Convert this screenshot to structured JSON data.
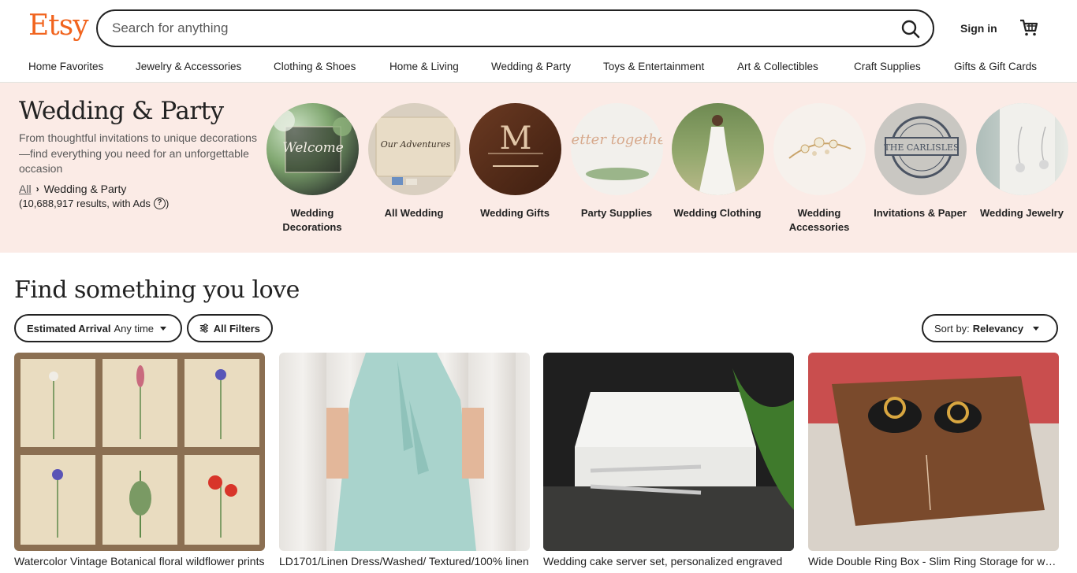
{
  "header": {
    "logo": "Etsy",
    "search_placeholder": "Search for anything",
    "sign_in": "Sign in"
  },
  "nav": [
    "Home Favorites",
    "Jewelry & Accessories",
    "Clothing & Shoes",
    "Home & Living",
    "Wedding & Party",
    "Toys & Entertainment",
    "Art & Collectibles",
    "Craft Supplies",
    "Gifts & Gift Cards"
  ],
  "hero": {
    "title": "Wedding & Party",
    "description": "From thoughtful invitations to unique decorations—find everything you need for an unforgettable occasion",
    "breadcrumb_all": "All",
    "breadcrumb_current": "Wedding & Party",
    "results_text": "(10,688,917 results, with Ads",
    "results_close": ")"
  },
  "categories": [
    {
      "label": "Wedding Decorations",
      "image_text": "Welcome"
    },
    {
      "label": "All Wedding",
      "image_text": "Our Adventures"
    },
    {
      "label": "Wedding Gifts",
      "image_text": "M"
    },
    {
      "label": "Party Supplies",
      "image_text": "better together"
    },
    {
      "label": "Wedding Clothing",
      "image_text": ""
    },
    {
      "label": "Wedding Accessories",
      "image_text": ""
    },
    {
      "label": "Invitations & Paper",
      "image_text": "THE CARLISLES"
    },
    {
      "label": "Wedding Jewelry",
      "image_text": ""
    }
  ],
  "find": {
    "title": "Find something you love",
    "filter_arrival_label": "Estimated Arrival",
    "filter_arrival_value": "Any time",
    "all_filters": "All Filters",
    "sort_label": "Sort by:",
    "sort_value": "Relevancy"
  },
  "products": [
    {
      "title": "Watercolor Vintage Botanical floral wildflower prints"
    },
    {
      "title": "LD1701/Linen Dress/Washed/ Textured/100% linen"
    },
    {
      "title": "Wedding cake server set, personalized engraved"
    },
    {
      "title": "Wide Double Ring Box - Slim Ring Storage for wedding"
    }
  ],
  "colors": {
    "brand": "#f1641e",
    "hero_bg": "#fbebe6",
    "text": "#222222"
  }
}
